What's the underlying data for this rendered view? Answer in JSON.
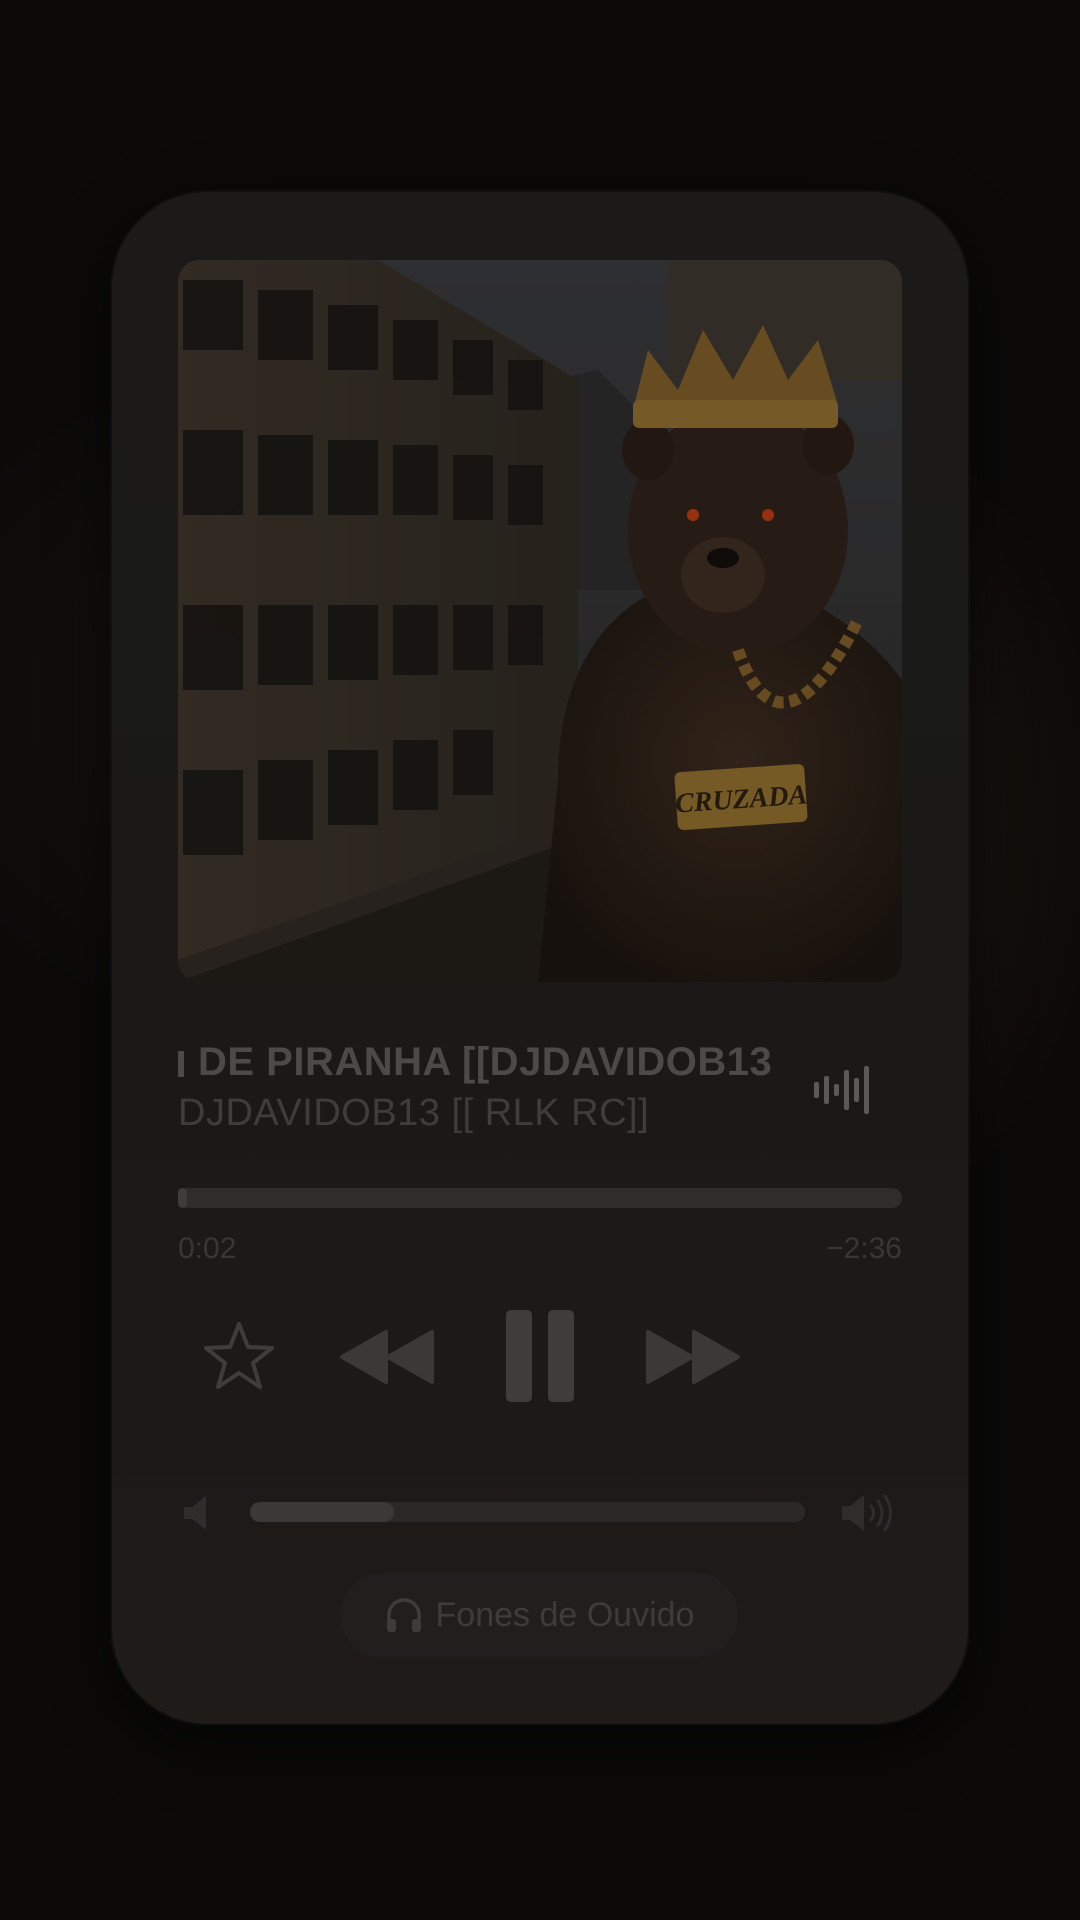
{
  "now_playing": {
    "title": "DE PIRANHA [[DJDAVIDOB13",
    "title_prefix": "",
    "artist": "DJDAVIDOB13  [[ RLK RC]]",
    "artwork_badge": "CRUZADA",
    "waveform_icon": "waveform-icon"
  },
  "progress": {
    "elapsed": "0:02",
    "remaining": "−2:36",
    "fraction": 0.012
  },
  "controls": {
    "favorite_icon": "star-icon",
    "previous_icon": "rewind-icon",
    "play_pause_icon": "pause-icon",
    "next_icon": "fast-forward-icon"
  },
  "volume": {
    "level": 0.26,
    "min_icon": "speaker-low-icon",
    "max_icon": "speaker-high-icon"
  },
  "output": {
    "label": "Fones de Ouvido",
    "icon": "headphones-icon"
  },
  "colors": {
    "background": "#0b0a09",
    "card": "#1b1a19",
    "text_dim": "#4b4a49",
    "control": "#3e3d3c"
  }
}
